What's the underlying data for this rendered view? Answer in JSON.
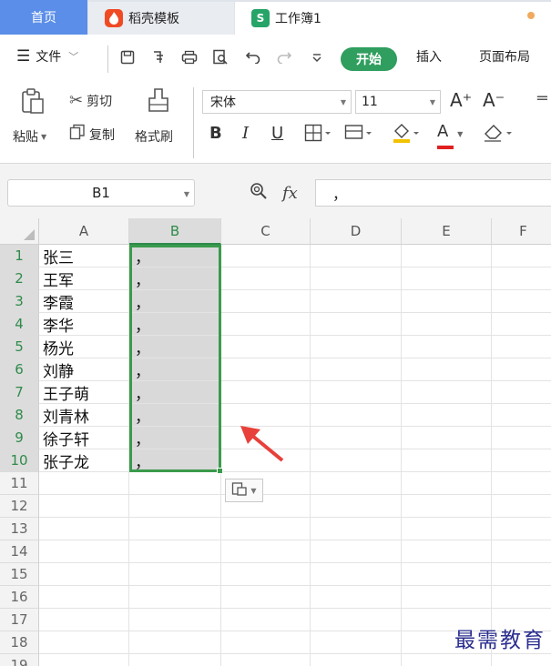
{
  "tabs": {
    "home": "首页",
    "template": "稻壳模板",
    "workbook": "工作簿1",
    "template_icon": "docer-icon",
    "workbook_icon": "spreadsheet-s-icon"
  },
  "menu": {
    "file": "文件",
    "start": "开始",
    "insert": "插入",
    "page_layout": "页面布局",
    "start_color": "#2f9e5e"
  },
  "ribbon": {
    "paste": "粘贴",
    "cut": "剪切",
    "copy": "复制",
    "format_painter": "格式刷",
    "font_name": "宋体",
    "font_size": "11",
    "bold": "B",
    "italic": "I",
    "underline": "U",
    "font_color_letter": "A",
    "font_color": "#e02020",
    "increase_font": "A⁺",
    "decrease_font": "A⁻"
  },
  "formula": {
    "name_box": "B1",
    "fx_label": "fx",
    "content": "，"
  },
  "grid": {
    "columns": [
      "A",
      "B",
      "C",
      "D",
      "E",
      "F"
    ],
    "rows": [
      {
        "num": "1",
        "a": "张三",
        "b": "，"
      },
      {
        "num": "2",
        "a": "王军",
        "b": "，"
      },
      {
        "num": "3",
        "a": "李霞",
        "b": "，"
      },
      {
        "num": "4",
        "a": "李华",
        "b": "，"
      },
      {
        "num": "5",
        "a": "杨光",
        "b": "，"
      },
      {
        "num": "6",
        "a": "刘静",
        "b": "，"
      },
      {
        "num": "7",
        "a": "王子萌",
        "b": "，"
      },
      {
        "num": "8",
        "a": "刘青林",
        "b": "，"
      },
      {
        "num": "9",
        "a": "徐子轩",
        "b": "，"
      },
      {
        "num": "10",
        "a": "张子龙",
        "b": "，"
      },
      {
        "num": "11",
        "a": "",
        "b": ""
      },
      {
        "num": "12",
        "a": "",
        "b": ""
      },
      {
        "num": "13",
        "a": "",
        "b": ""
      },
      {
        "num": "14",
        "a": "",
        "b": ""
      },
      {
        "num": "15",
        "a": "",
        "b": ""
      },
      {
        "num": "16",
        "a": "",
        "b": ""
      },
      {
        "num": "17",
        "a": "",
        "b": ""
      },
      {
        "num": "18",
        "a": "",
        "b": ""
      },
      {
        "num": "19",
        "a": "",
        "b": ""
      }
    ],
    "selected_column": "B",
    "selection_color": "#3a9a4c",
    "annotation_arrow_color": "#e8403a"
  },
  "watermark": "最需教育"
}
